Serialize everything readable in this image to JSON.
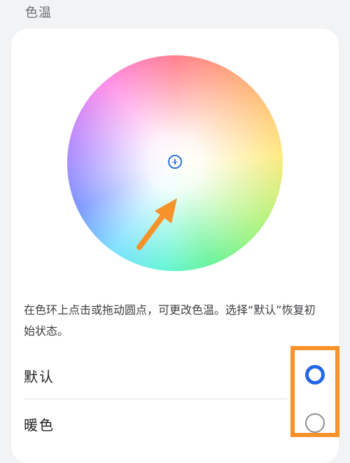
{
  "section": {
    "title": "色温"
  },
  "wheel": {
    "center_icon": "plus-circle-icon",
    "pointer_icon": "orange-arrow-icon",
    "accent_color": "#2f75d8",
    "arrow_color": "#f7922b"
  },
  "description": "在色环上点击或拖动圆点，可更改色温。选择“默认”恢复初始状态。",
  "options": [
    {
      "label": "默认",
      "selected": true
    },
    {
      "label": "暖色",
      "selected": false
    }
  ]
}
